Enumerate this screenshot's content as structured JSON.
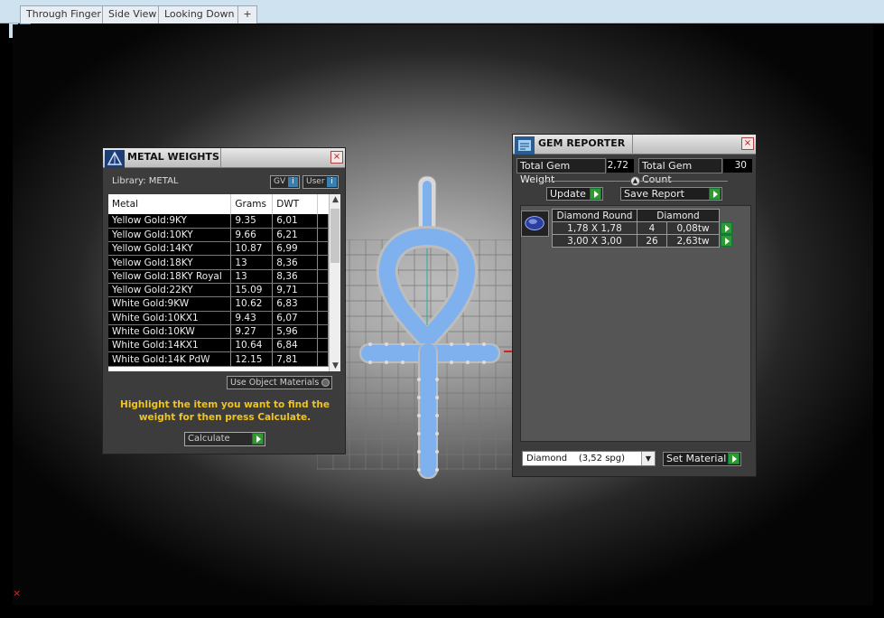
{
  "view_tabs": [
    "Through Finger",
    "Side View",
    "Looking Down"
  ],
  "add_tab_glyph": "+",
  "colors": {
    "tab_strip": "#cfe2ef",
    "panel_bg": "#3c3c3c",
    "hint_text": "#f0c420",
    "arrow_green": "#2f9a2f",
    "gem_blue": "#7fb1ef",
    "prong_silver": "#c8c8c8",
    "axis_red": "#cc2222"
  },
  "metal_weights": {
    "title": "METAL WEIGHTS",
    "icon": "metal-weights-icon",
    "library_label": "Library: METAL",
    "gv_label": "GV",
    "user_label": "User",
    "columns": [
      "Metal",
      "Grams",
      "DWT"
    ],
    "rows": [
      [
        "Yellow Gold:9KY",
        "9.35",
        "6,01"
      ],
      [
        "Yellow Gold:10KY",
        "9.66",
        "6,21"
      ],
      [
        "Yellow Gold:14KY",
        "10.87",
        "6,99"
      ],
      [
        "Yellow Gold:18KY",
        "13",
        "8,36"
      ],
      [
        "Yellow Gold:18KY Royal",
        "13",
        "8,36"
      ],
      [
        "Yellow Gold:22KY",
        "15.09",
        "9,71"
      ],
      [
        "White Gold:9KW",
        "10.62",
        "6,83"
      ],
      [
        "White Gold:10KX1",
        "9.43",
        "6,07"
      ],
      [
        "White Gold:10KW",
        "9.27",
        "5,96"
      ],
      [
        "White Gold:14KX1",
        "10.64",
        "6,84"
      ],
      [
        "White Gold:14K PdW",
        "12.15",
        "7,81"
      ]
    ],
    "use_object_materials": "Use Object Materials",
    "hint": "Highlight the item you want to find the weight for then press Calculate.",
    "calculate_label": "Calculate"
  },
  "gem_reporter": {
    "title": "GEM REPORTER",
    "icon": "gem-reporter-icon",
    "total_weight_label": "Total Gem Weight",
    "total_weight_value": "2,72",
    "total_count_label": "Total Gem Count",
    "total_count_value": "30",
    "update_label": "Update",
    "save_report_label": "Save Report",
    "table_headers": [
      "Diamond Round",
      "Diamond"
    ],
    "rows": [
      {
        "size": "1,78 X 1,78",
        "count": "4",
        "weight": "0,08tw"
      },
      {
        "size": "3,00 X 3,00",
        "count": "26",
        "weight": "2,63tw"
      }
    ],
    "material_value": "Diamond    (3,52 spg)",
    "set_material_label": "Set Material"
  }
}
